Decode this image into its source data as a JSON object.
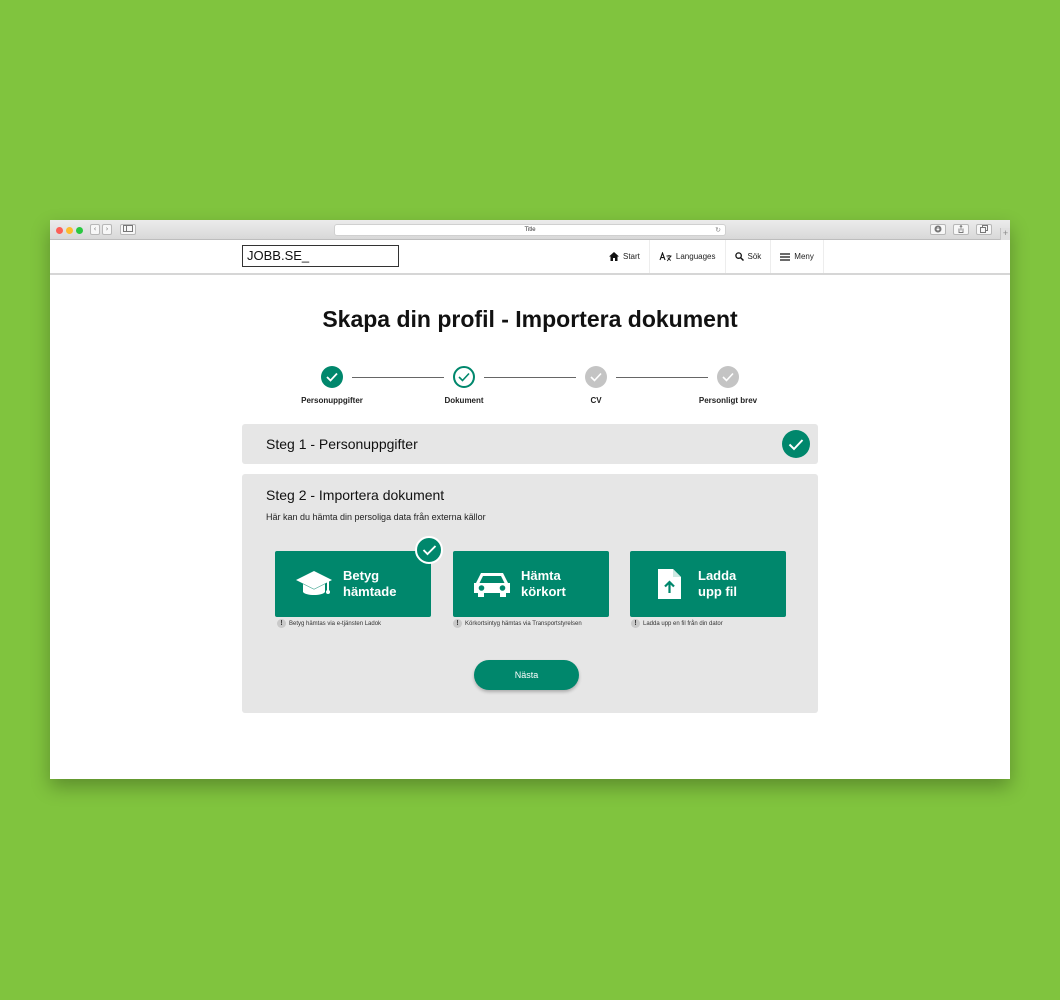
{
  "browser": {
    "tab_title": "Title",
    "back": "‹",
    "forward": "›",
    "reload": "↻",
    "new_tab": "+"
  },
  "header": {
    "logo": "JOBB.SE_",
    "nav": [
      {
        "label": "Start",
        "icon": "home-icon"
      },
      {
        "label": "Languages",
        "icon": "translate-icon"
      },
      {
        "label": "Sök",
        "icon": "search-icon"
      },
      {
        "label": "Meny",
        "icon": "menu-icon"
      }
    ]
  },
  "page": {
    "title": "Skapa din profil - Importera dokument"
  },
  "stepper": {
    "steps": [
      {
        "label": "Personuppgifter",
        "state": "done"
      },
      {
        "label": "Dokument",
        "state": "active"
      },
      {
        "label": "CV",
        "state": "todo"
      },
      {
        "label": "Personligt brev",
        "state": "todo"
      }
    ]
  },
  "step1": {
    "title": "Steg 1 - Personuppgifter",
    "completed": true
  },
  "step2": {
    "title": "Steg 2 - Importera dokument",
    "description": "Här kan du hämta din persoliga data från externa källor",
    "cards": [
      {
        "line1": "Betyg",
        "line2": "hämtade",
        "icon": "graduation-cap-icon",
        "note": "Betyg hämtas via e-tjänsten Ladok",
        "completed": true
      },
      {
        "line1": "Hämta",
        "line2": "körkort",
        "icon": "car-icon",
        "note": "Körkortsintyg hämtas via Transportstyrelsen",
        "completed": false
      },
      {
        "line1": "Ladda",
        "line2": "upp fil",
        "icon": "file-upload-icon",
        "note": "Ladda upp en fil från din dator",
        "completed": false
      }
    ],
    "note_icon_glyph": "!",
    "next_label": "Nästa"
  },
  "colors": {
    "accent": "#00876c",
    "background": "#80c43e",
    "panel": "#e6e6e6",
    "inactive": "#c4c4c4"
  }
}
